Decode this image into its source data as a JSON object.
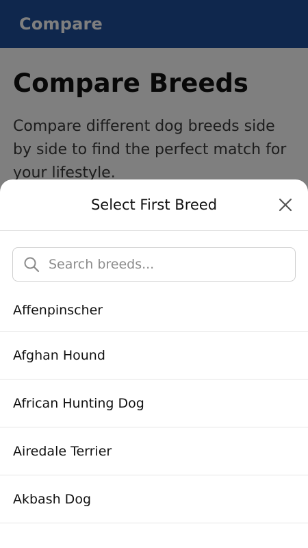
{
  "app_bar": {
    "title": "Compare"
  },
  "page": {
    "title": "Compare Breeds",
    "description": "Compare different dog breeds side by side to find the perfect match for your lifestyle."
  },
  "sheet": {
    "title": "Select First Breed",
    "close_icon": "close-icon",
    "search": {
      "placeholder": "Search breeds...",
      "value": "",
      "icon": "search-icon"
    },
    "breeds": [
      {
        "label": "Affenpinscher"
      },
      {
        "label": "Afghan Hound"
      },
      {
        "label": "African Hunting Dog"
      },
      {
        "label": "Airedale Terrier"
      },
      {
        "label": "Akbash Dog"
      }
    ]
  },
  "colors": {
    "app_bar": "#1f4e9a",
    "scrim": "rgba(0,0,0,0.5)",
    "divider": "#e4e4e4"
  }
}
